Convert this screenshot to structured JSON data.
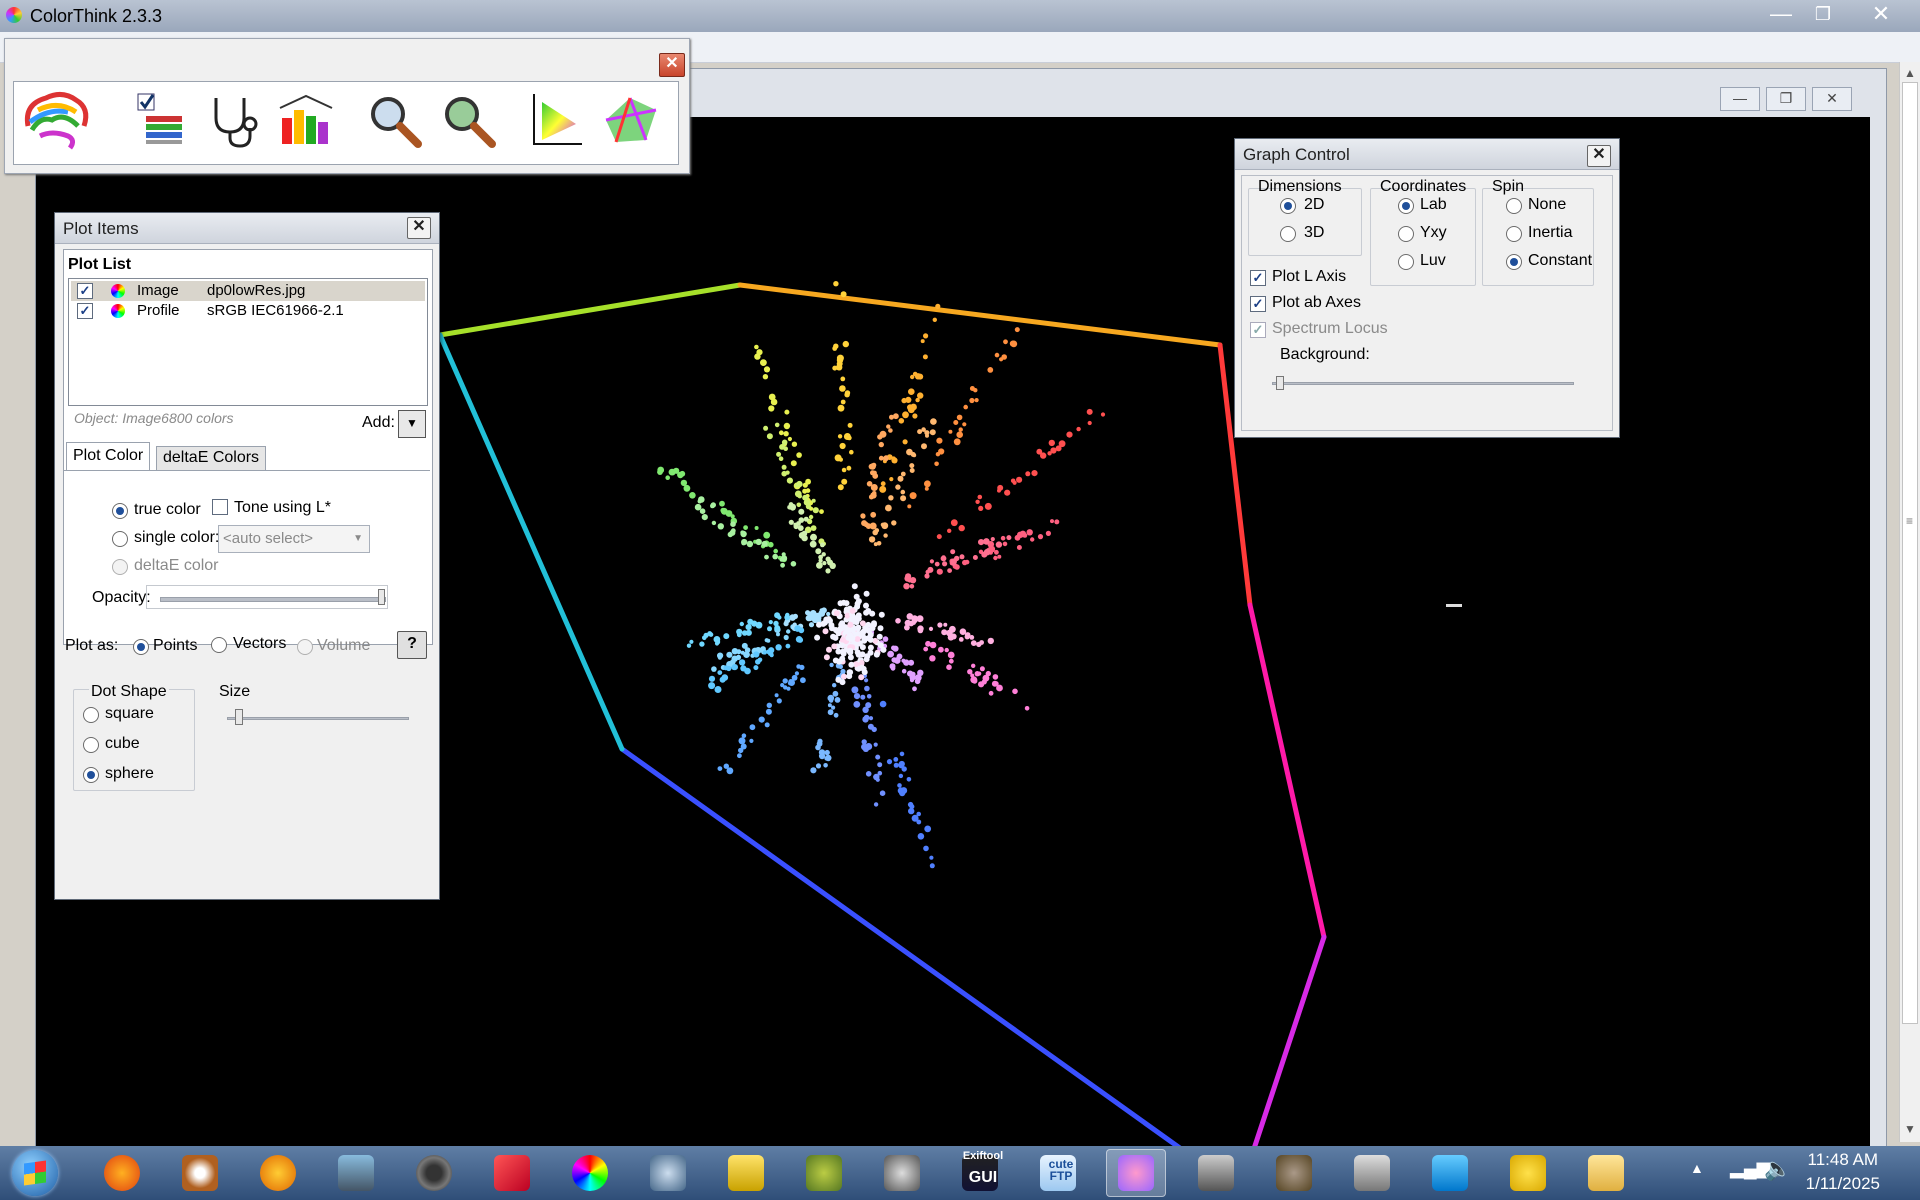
{
  "app": {
    "title": "ColorThink 2.3.3"
  },
  "toolbar": {
    "tools": [
      "brain-icon",
      "image-list-icon",
      "stethoscope-icon",
      "gamut-bars-icon",
      "zoom-in-icon",
      "zoom-out-icon",
      "gamut-2d-icon",
      "gamut-3d-icon"
    ]
  },
  "plot_items": {
    "title": "Plot Items",
    "list_header": "Plot List",
    "rows": [
      {
        "type": "Image",
        "name": "dp0lowRes.jpg",
        "checked": true
      },
      {
        "type": "Profile",
        "name": "sRGB IEC61966-2.1",
        "checked": true
      }
    ],
    "object_info": "Object: Image6800 colors",
    "add_label": "Add:",
    "tabs": [
      "Plot Color",
      "deltaE Colors"
    ],
    "color_options": [
      "true color",
      "single color:",
      "deltaE color"
    ],
    "tone_label": "Tone using L*",
    "single_color_value": "<auto select>",
    "opacity_label": "Opacity:",
    "plot_as_label": "Plot as:",
    "plot_as_options": [
      "Points",
      "Vectors",
      "Volume"
    ],
    "help_label": "?",
    "dot_shape_label": "Dot Shape",
    "dot_shapes": [
      "square",
      "cube",
      "sphere"
    ],
    "size_label": "Size"
  },
  "graph_control": {
    "title": "Graph Control",
    "dimensions_label": "Dimensions",
    "dimensions": [
      "2D",
      "3D"
    ],
    "coordinates_label": "Coordinates",
    "coordinates": [
      "Lab",
      "Yxy",
      "Luv"
    ],
    "spin_label": "Spin",
    "spin": [
      "None",
      "Inertia",
      "Constant"
    ],
    "checks": [
      "Plot L Axis",
      "Plot ab Axes",
      "Spectrum Locus"
    ],
    "background_label": "Background:"
  },
  "taskbar": {
    "time": "11:48 AM",
    "date": "1/11/2025",
    "exiftool_label_top": "Exiftool",
    "exiftool_label_bottom": "GUI",
    "cuteftp_label_top": "cute",
    "cuteftp_label_bottom": "FTP"
  },
  "colors": {
    "plot_bg": "#000000",
    "titlebar": "#a9b5c7",
    "taskbar": "#3f5f8a"
  }
}
